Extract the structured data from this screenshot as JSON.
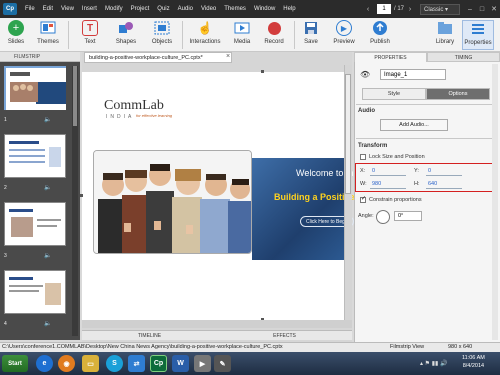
{
  "menubar": {
    "logo": "Cp",
    "items": [
      "File",
      "Edit",
      "View",
      "Insert",
      "Modify",
      "Project",
      "Quiz",
      "Audio",
      "Video",
      "Themes",
      "Window",
      "Help"
    ],
    "page_current": "1",
    "page_total": "/ 17",
    "workspace": "Classic"
  },
  "toolbar": {
    "slides": "Slides",
    "themes": "Themes",
    "text": "Text",
    "shapes": "Shapes",
    "objects": "Objects",
    "interactions": "Interactions",
    "media": "Media",
    "record": "Record",
    "save": "Save",
    "preview": "Preview",
    "publish": "Publish",
    "library": "Library",
    "properties": "Properties"
  },
  "filmstrip": {
    "header": "FILMSTRIP",
    "slides": [
      "1",
      "2",
      "3",
      "4"
    ]
  },
  "document": {
    "tab_title": "building-a-positive-workplace-culture_PC.cptx*"
  },
  "slide": {
    "brand_comm": "CommLab",
    "brand_india": "INDIA",
    "tagline": "for effective learning",
    "welcome": "Welcome to th",
    "building": "Building a Positive W",
    "click_button": "Click Here to Begin"
  },
  "bottom_tabs": [
    "TIMELINE",
    "EFFECTS"
  ],
  "properties": {
    "tabs": [
      "PROPERTIES",
      "TIMING"
    ],
    "object_name": "Image_1",
    "subtabs": [
      "Style",
      "Options"
    ],
    "audio_label": "Audio",
    "add_audio": "Add Audio...",
    "transform_label": "Transform",
    "lock_label": "Lock Size and Position",
    "x_label": "X:",
    "x_value": "0",
    "y_label": "Y:",
    "y_value": "0",
    "w_label": "W:",
    "w_value": "980",
    "h_label": "H:",
    "h_value": "640",
    "constrain_label": "Constrain proportions",
    "angle_label": "Angle:",
    "angle_value": "0°"
  },
  "statusbar": {
    "path": "C:\\Users\\conference1.COMMLAB\\Desktop\\New China News Agency\\building-a-positive-workplace-culture_PC.cptx",
    "view": "Filmstrip View",
    "dimensions": "980 x 640"
  },
  "taskbar": {
    "start": "Start",
    "time": "11:06 AM",
    "date": "8/4/2014"
  }
}
